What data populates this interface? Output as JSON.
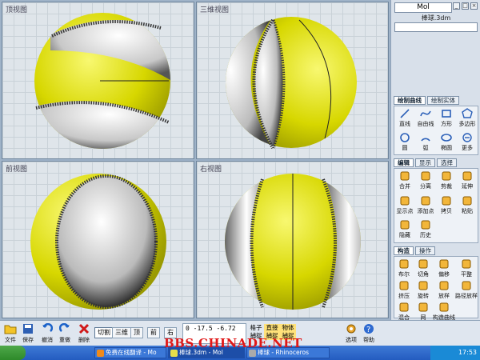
{
  "viewports": [
    {
      "title": "顶视图"
    },
    {
      "title": "三维视图"
    },
    {
      "title": "前视图"
    },
    {
      "title": "右视图"
    }
  ],
  "panel": {
    "mol": "Mol",
    "file_name": "棒球.3dm",
    "curve_tabs": [
      "绘制曲线",
      "绘制实体"
    ],
    "curve_tools": [
      {
        "label": "直线",
        "icon": "line-icon"
      },
      {
        "label": "自由线",
        "icon": "freeform-icon"
      },
      {
        "label": "方形",
        "icon": "rectangle-icon"
      },
      {
        "label": "多边形",
        "icon": "polygon-icon"
      },
      {
        "label": "圆",
        "icon": "circle-icon"
      },
      {
        "label": "弧",
        "icon": "arc-icon"
      },
      {
        "label": "椭圆",
        "icon": "ellipse-icon"
      },
      {
        "label": "更多",
        "icon": "more-icon"
      }
    ],
    "edit_tabs": [
      "编辑",
      "显示",
      "选择"
    ],
    "edit_tools": [
      {
        "label": "合并",
        "icon": "join-icon"
      },
      {
        "label": "分离",
        "icon": "separate-icon"
      },
      {
        "label": "剪裁",
        "icon": "trim-icon"
      },
      {
        "label": "延伸",
        "icon": "extend-icon"
      },
      {
        "label": "显示点",
        "icon": "show-points-icon"
      },
      {
        "label": "添加点",
        "icon": "add-point-icon"
      },
      {
        "label": "拷贝",
        "icon": "copy-icon"
      },
      {
        "label": "粘贴",
        "icon": "paste-icon"
      },
      {
        "label": "隐藏",
        "icon": "hide-icon"
      },
      {
        "label": "历史",
        "icon": "history-icon"
      }
    ],
    "construct_tabs": [
      "构造",
      "操作"
    ],
    "construct_tools": [
      {
        "label": "布尔",
        "icon": "boolean-icon"
      },
      {
        "label": "切角",
        "icon": "chamfer-icon"
      },
      {
        "label": "偏移",
        "icon": "offset-icon"
      },
      {
        "label": "平整",
        "icon": "planar-icon"
      },
      {
        "label": "挤压",
        "icon": "extrude-icon"
      },
      {
        "label": "旋转",
        "icon": "revolve-icon"
      },
      {
        "label": "放样",
        "icon": "loft-icon"
      },
      {
        "label": "路径放样",
        "icon": "sweep-icon"
      },
      {
        "label": "混合",
        "icon": "blend-icon"
      },
      {
        "label": "网",
        "icon": "network-icon"
      },
      {
        "label": "构造曲线",
        "icon": "construct-curve-icon"
      }
    ]
  },
  "toolbar": {
    "file": "文件",
    "save": "保存",
    "undo": "撤消",
    "redo": "重做",
    "delete": "删除",
    "view_buttons": [
      "切割",
      "三维",
      "顶",
      "前",
      "右"
    ],
    "coord_line1": "0    -17.5  -6.72",
    "coord_line2": "",
    "grid_snap": "格子\n捕捉",
    "straight_snap": "直接\n捕捉",
    "object_snap": "物体\n捕捉",
    "options": "选项",
    "help": "帮助"
  },
  "taskbar": {
    "tasks": [
      "免费在线翻译 - Mo",
      "棒球.3dm - Mol",
      "棒球 - Rhinoceros"
    ],
    "clock": "17:53"
  },
  "watermark": "BBS.CHINADE.NET",
  "colors": {
    "ball_yellow": "#e4e40a",
    "ball_white": "#f2f2f2"
  }
}
